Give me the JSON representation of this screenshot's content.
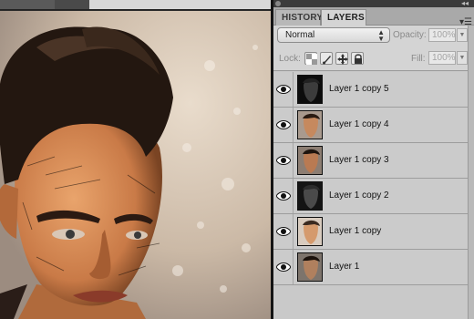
{
  "panel": {
    "tabs": [
      {
        "label": "HISTORY",
        "active": false
      },
      {
        "label": "LAYERS",
        "active": true
      }
    ],
    "blend_mode": "Normal",
    "opacity_label": "Opacity:",
    "opacity_value": "100%",
    "lock_label": "Lock:",
    "fill_label": "Fill:",
    "fill_value": "100%",
    "lock_icons": [
      "lock-transparency-icon",
      "lock-paint-icon",
      "lock-position-icon",
      "lock-all-icon"
    ]
  },
  "layers": [
    {
      "name": "Layer 1 copy 5",
      "visible": true,
      "thumb": "dark"
    },
    {
      "name": "Layer 1 copy 4",
      "visible": true,
      "thumb": "color"
    },
    {
      "name": "Layer 1 copy 3",
      "visible": true,
      "thumb": "color"
    },
    {
      "name": "Layer 1 copy 2",
      "visible": true,
      "thumb": "dark"
    },
    {
      "name": "Layer 1 copy",
      "visible": true,
      "thumb": "light"
    },
    {
      "name": "Layer 1",
      "visible": true,
      "thumb": "color"
    }
  ],
  "colors": {
    "panel_bg": "#c8c8c8",
    "canvas_bg": "#2a2a2a"
  }
}
